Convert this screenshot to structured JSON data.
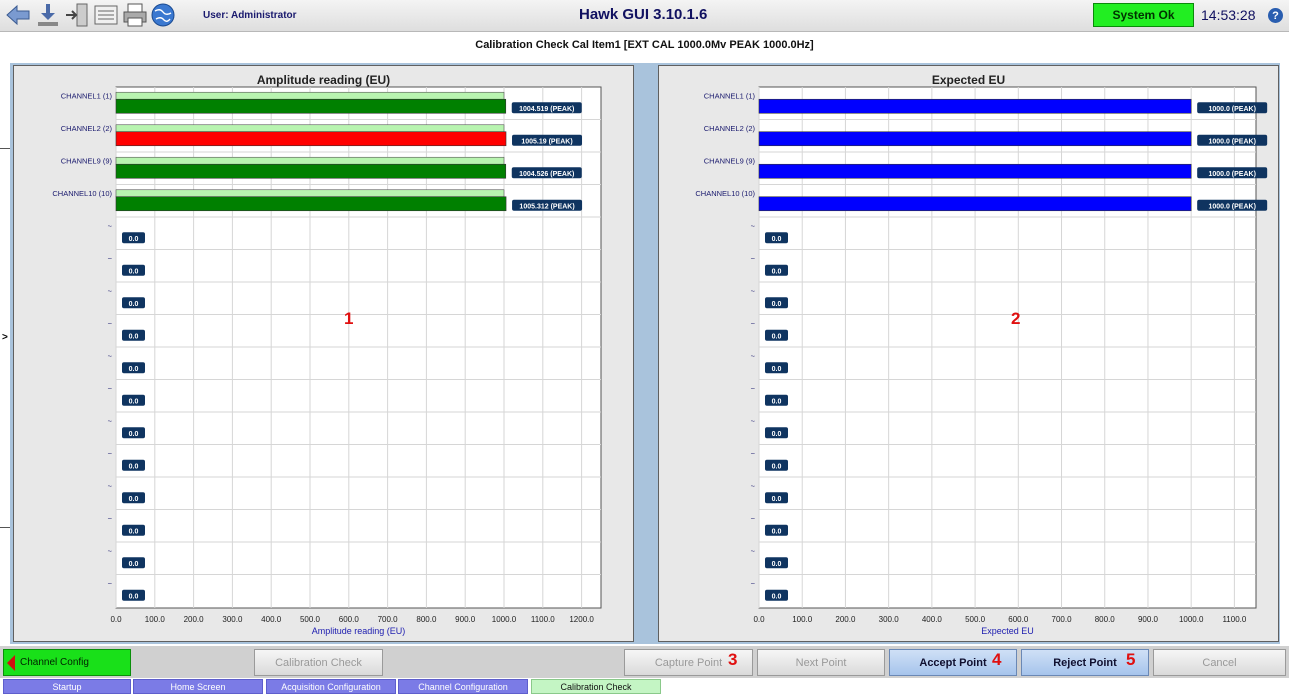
{
  "toolbar": {
    "icons": [
      "back-arrow-icon",
      "download-icon",
      "export-icon",
      "settings-panel-icon",
      "print-icon",
      "globe-icon"
    ]
  },
  "header": {
    "user": "User: Administrator",
    "title": "Hawk GUI 3.10.1.6",
    "status": "System Ok",
    "time": "14:53:28",
    "help": "?"
  },
  "subtitle": "Calibration Check Cal Item1 [EXT CAL 1000.0Mv PEAK 1000.0Hz]",
  "left_handle": ">",
  "colors": {
    "ok": "#008000",
    "alert": "#ff0000",
    "light": "#b8f4b0",
    "expected": "#0000ff",
    "label_bg": "#0f3460",
    "annotation": "#e01010"
  },
  "panels": {
    "amplitude": {
      "title": "Amplitude reading (EU)",
      "annotation": "1"
    },
    "expected": {
      "title": "Expected EU",
      "annotation": "2"
    }
  },
  "chart_data": [
    {
      "type": "bar",
      "orientation": "horizontal",
      "title": "Amplitude reading (EU)",
      "xlabel": "Amplitude reading (EU)",
      "xlim": [
        0,
        1250
      ],
      "xticks": [
        "0.0",
        "100.0",
        "200.0",
        "300.0",
        "400.0",
        "500.0",
        "600.0",
        "700.0",
        "800.0",
        "900.0",
        "1000.0",
        "1100.0",
        "1200.0"
      ],
      "xtick_values": [
        0,
        100,
        200,
        300,
        400,
        500,
        600,
        700,
        800,
        900,
        1000,
        1100,
        1200
      ],
      "rows": [
        {
          "label": "CHANNEL1 (1)",
          "value": 1004.519,
          "value_label": "1004.519 (PEAK)",
          "expected": 1000,
          "color": "#008000"
        },
        {
          "label": "CHANNEL2 (2)",
          "value": 1005.19,
          "value_label": "1005.19 (PEAK)",
          "expected": 1000,
          "color": "#ff0000"
        },
        {
          "label": "CHANNEL9 (9)",
          "value": 1004.526,
          "value_label": "1004.526 (PEAK)",
          "expected": 1000,
          "color": "#008000"
        },
        {
          "label": "CHANNEL10 (10)",
          "value": 1005.312,
          "value_label": "1005.312 (PEAK)",
          "expected": 1000,
          "color": "#008000"
        },
        {
          "label": "~",
          "value": 0,
          "value_label": "0.0"
        },
        {
          "label": "~",
          "value": 0,
          "value_label": "0.0"
        },
        {
          "label": "~",
          "value": 0,
          "value_label": "0.0"
        },
        {
          "label": "~",
          "value": 0,
          "value_label": "0.0"
        },
        {
          "label": "~",
          "value": 0,
          "value_label": "0.0"
        },
        {
          "label": "~",
          "value": 0,
          "value_label": "0.0"
        },
        {
          "label": "~",
          "value": 0,
          "value_label": "0.0"
        },
        {
          "label": "~",
          "value": 0,
          "value_label": "0.0"
        },
        {
          "label": "~",
          "value": 0,
          "value_label": "0.0"
        },
        {
          "label": "~",
          "value": 0,
          "value_label": "0.0"
        },
        {
          "label": "~",
          "value": 0,
          "value_label": "0.0"
        },
        {
          "label": "~",
          "value": 0,
          "value_label": "0.0"
        }
      ],
      "grid": true
    },
    {
      "type": "bar",
      "orientation": "horizontal",
      "title": "Expected EU",
      "xlabel": "Expected EU",
      "xlim": [
        0,
        1150
      ],
      "xticks": [
        "0.0",
        "100.0",
        "200.0",
        "300.0",
        "400.0",
        "500.0",
        "600.0",
        "700.0",
        "800.0",
        "900.0",
        "1000.0",
        "1100.0"
      ],
      "xtick_values": [
        0,
        100,
        200,
        300,
        400,
        500,
        600,
        700,
        800,
        900,
        1000,
        1100
      ],
      "rows": [
        {
          "label": "CHANNEL1 (1)",
          "value": 1000.0,
          "value_label": "1000.0 (PEAK)",
          "color": "#0000ff"
        },
        {
          "label": "CHANNEL2 (2)",
          "value": 1000.0,
          "value_label": "1000.0 (PEAK)",
          "color": "#0000ff"
        },
        {
          "label": "CHANNEL9 (9)",
          "value": 1000.0,
          "value_label": "1000.0 (PEAK)",
          "color": "#0000ff"
        },
        {
          "label": "CHANNEL10 (10)",
          "value": 1000.0,
          "value_label": "1000.0 (PEAK)",
          "color": "#0000ff"
        },
        {
          "label": "~",
          "value": 0,
          "value_label": "0.0"
        },
        {
          "label": "~",
          "value": 0,
          "value_label": "0.0"
        },
        {
          "label": "~",
          "value": 0,
          "value_label": "0.0"
        },
        {
          "label": "~",
          "value": 0,
          "value_label": "0.0"
        },
        {
          "label": "~",
          "value": 0,
          "value_label": "0.0"
        },
        {
          "label": "~",
          "value": 0,
          "value_label": "0.0"
        },
        {
          "label": "~",
          "value": 0,
          "value_label": "0.0"
        },
        {
          "label": "~",
          "value": 0,
          "value_label": "0.0"
        },
        {
          "label": "~",
          "value": 0,
          "value_label": "0.0"
        },
        {
          "label": "~",
          "value": 0,
          "value_label": "0.0"
        },
        {
          "label": "~",
          "value": 0,
          "value_label": "0.0"
        },
        {
          "label": "~",
          "value": 0,
          "value_label": "0.0"
        }
      ],
      "grid": true
    }
  ],
  "buttons": {
    "channel_config": "Channel Config",
    "calibration_check": "Calibration Check",
    "capture_point": "Capture Point",
    "capture_annotation": "3",
    "next_point": "Next Point",
    "accept_point": "Accept Point",
    "accept_annotation": "4",
    "reject_point": "Reject Point",
    "reject_annotation": "5",
    "cancel": "Cancel"
  },
  "nav_tabs": [
    {
      "label": "Startup",
      "current": false
    },
    {
      "label": "Home Screen",
      "current": false
    },
    {
      "label": "Acquisition Configuration",
      "current": false
    },
    {
      "label": "Channel Configuration",
      "current": false
    },
    {
      "label": "Calibration Check",
      "current": true
    }
  ]
}
